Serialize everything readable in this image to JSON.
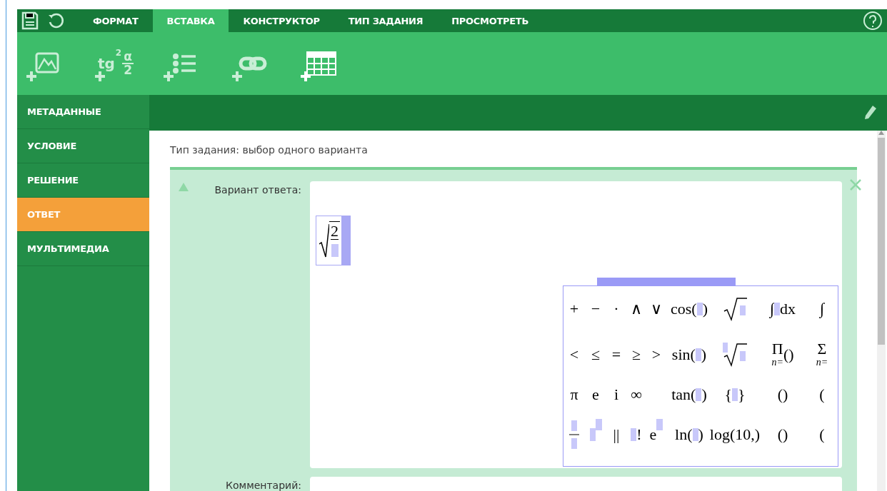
{
  "toolbar": {
    "tabs": [
      {
        "label": "ФОРМАТ",
        "selected": false
      },
      {
        "label": "ВСТАВКА",
        "selected": true
      },
      {
        "label": "КОНСТРУКТОР",
        "selected": false
      },
      {
        "label": "ТИП ЗАДАНИЯ",
        "selected": false
      },
      {
        "label": "ПРОСМОТРЕТЬ",
        "selected": false
      }
    ],
    "formula_icon": {
      "base": "tg",
      "power": "2",
      "numerator": "α",
      "denominator": "2"
    }
  },
  "sidebar": {
    "items": [
      {
        "label": "МЕТАДАННЫЕ",
        "selected": false
      },
      {
        "label": "УСЛОВИЕ",
        "selected": false
      },
      {
        "label": "РЕШЕНИЕ",
        "selected": false
      },
      {
        "label": "ОТВЕТ",
        "selected": true
      },
      {
        "label": "МУЛЬТИМЕДИА",
        "selected": false
      }
    ]
  },
  "task_type": "Тип задания: выбор одного варианта",
  "answer": {
    "label": "Вариант ответа:",
    "radicand": "2"
  },
  "palette": {
    "rows": [
      [
        {
          "kind": "symbol",
          "text": "+"
        },
        {
          "kind": "symbol",
          "text": "−"
        },
        {
          "kind": "symbol",
          "text": "·"
        },
        {
          "kind": "symbol",
          "text": "∧"
        },
        {
          "kind": "symbol",
          "text": "∨"
        },
        {
          "kind": "func",
          "pre": "cos(",
          "post": ")"
        },
        {
          "kind": "root",
          "indexed": false
        },
        {
          "kind": "func",
          "pre": "∫",
          "post": "dx"
        },
        {
          "kind": "big",
          "text": "∫"
        }
      ],
      [
        {
          "kind": "symbol",
          "text": "<"
        },
        {
          "kind": "symbol",
          "text": "≤"
        },
        {
          "kind": "symbol",
          "text": "="
        },
        {
          "kind": "symbol",
          "text": "≥"
        },
        {
          "kind": "symbol",
          "text": ">"
        },
        {
          "kind": "func",
          "pre": "sin(",
          "post": ")"
        },
        {
          "kind": "root",
          "indexed": true
        },
        {
          "kind": "big",
          "text": "Π",
          "sub": "n=",
          "post": "()"
        },
        {
          "kind": "big",
          "text": "Σ",
          "sub": "n="
        }
      ],
      [
        {
          "kind": "symbol",
          "text": "π"
        },
        {
          "kind": "symbol",
          "text": "e"
        },
        {
          "kind": "symbol",
          "text": "i"
        },
        {
          "kind": "symbol",
          "text": "∞"
        },
        {
          "kind": "empty"
        },
        {
          "kind": "func",
          "pre": "tan(",
          "post": ")"
        },
        {
          "kind": "func",
          "pre": "{",
          "post": "}"
        },
        {
          "kind": "symbol",
          "text": "()"
        },
        {
          "kind": "symbol",
          "text": "("
        }
      ],
      [
        {
          "kind": "frac"
        },
        {
          "kind": "power"
        },
        {
          "kind": "symbol",
          "text": "||"
        },
        {
          "kind": "postfix",
          "text": "!"
        },
        {
          "kind": "power",
          "base": "e"
        },
        {
          "kind": "func",
          "pre": "ln(",
          "post": ")"
        },
        {
          "kind": "func",
          "pre": "log(10,",
          "post": ")"
        },
        {
          "kind": "symbol",
          "text": "()"
        },
        {
          "kind": "symbol",
          "text": "("
        }
      ]
    ]
  },
  "comment": {
    "label": "Комментарий:"
  }
}
